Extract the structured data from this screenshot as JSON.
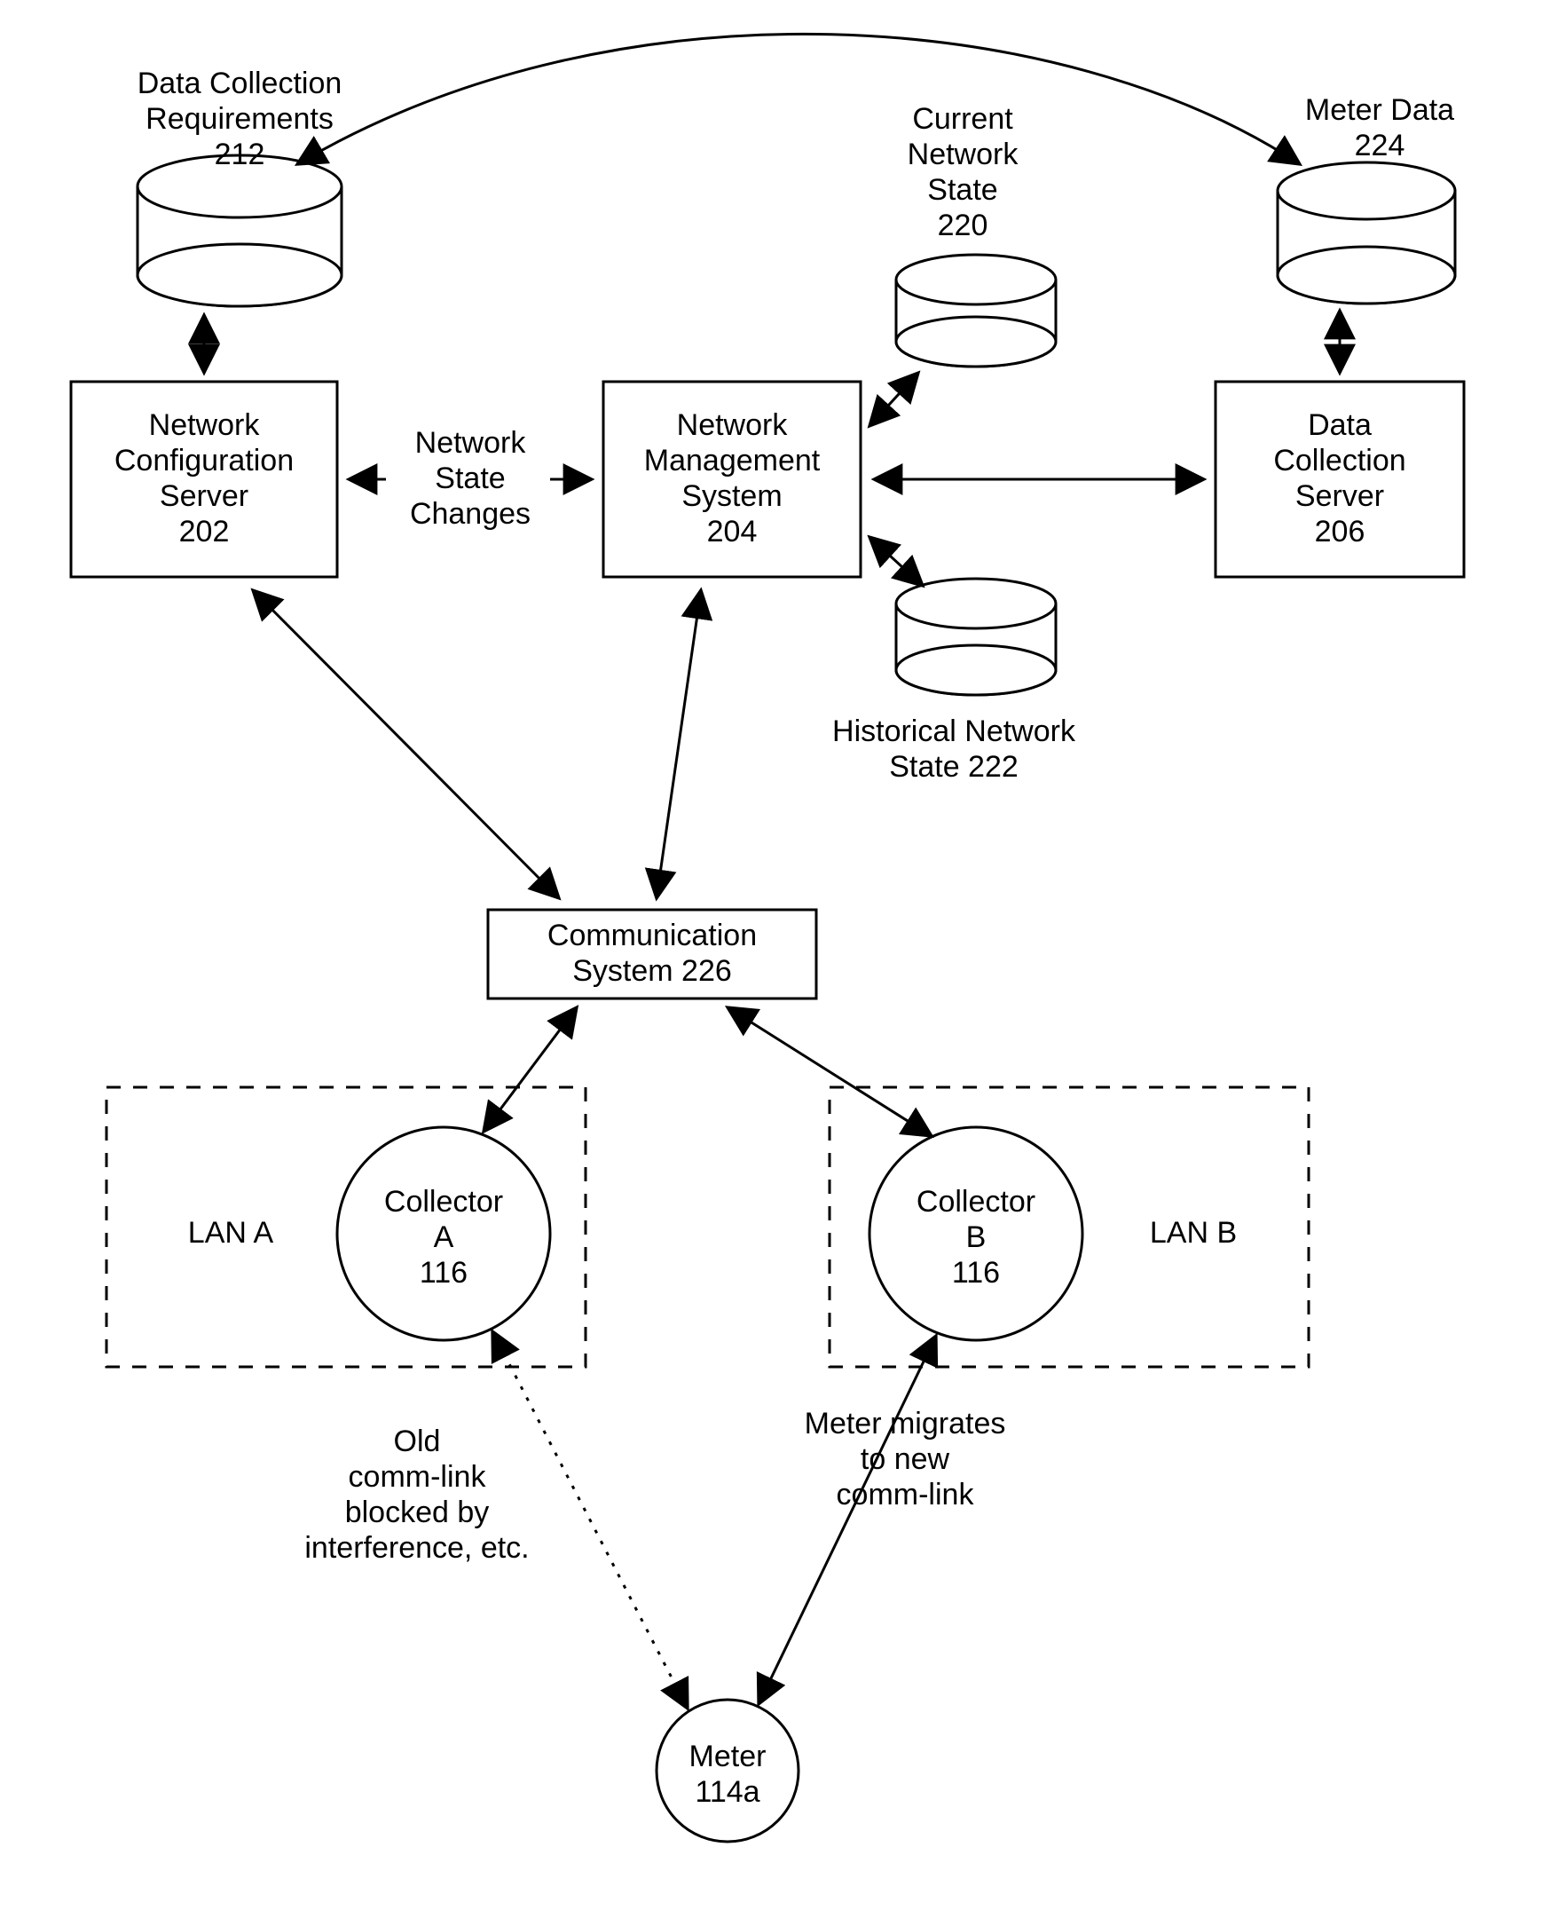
{
  "nodes": {
    "dcr": {
      "label_l1": "Data Collection",
      "label_l2": "Requirements",
      "label_l3": "212"
    },
    "cns": {
      "label_l1": "Current",
      "label_l2": "Network",
      "label_l3": "State",
      "label_l4": "220"
    },
    "md": {
      "label_l1": "Meter Data",
      "label_l2": "224"
    },
    "ncs": {
      "label_l1": "Network",
      "label_l2": "Configuration",
      "label_l3": "Server",
      "label_l4": "202"
    },
    "nms": {
      "label_l1": "Network",
      "label_l2": "Management",
      "label_l3": "System",
      "label_l4": "204"
    },
    "dcs": {
      "label_l1": "Data",
      "label_l2": "Collection",
      "label_l3": "Server",
      "label_l4": "206"
    },
    "hns": {
      "label_l1": "Historical Network",
      "label_l2": "State 222"
    },
    "cs": {
      "label_l1": "Communication",
      "label_l2": "System 226"
    },
    "colA": {
      "label_l1": "Collector",
      "label_l2": "A",
      "label_l3": "116"
    },
    "colB": {
      "label_l1": "Collector",
      "label_l2": "B",
      "label_l3": "116"
    },
    "lanA": {
      "label": "LAN A"
    },
    "lanB": {
      "label": "LAN B"
    },
    "meter": {
      "label_l1": "Meter",
      "label_l2": "114a"
    }
  },
  "edges": {
    "nsc": {
      "label_l1": "Network",
      "label_l2": "State",
      "label_l3": "Changes"
    },
    "old": {
      "label_l1": "Old",
      "label_l2": "comm-link",
      "label_l3": "blocked by",
      "label_l4": "interference, etc."
    },
    "mig": {
      "label_l1": "Meter migrates",
      "label_l2": "to new",
      "label_l3": "comm-link"
    }
  }
}
